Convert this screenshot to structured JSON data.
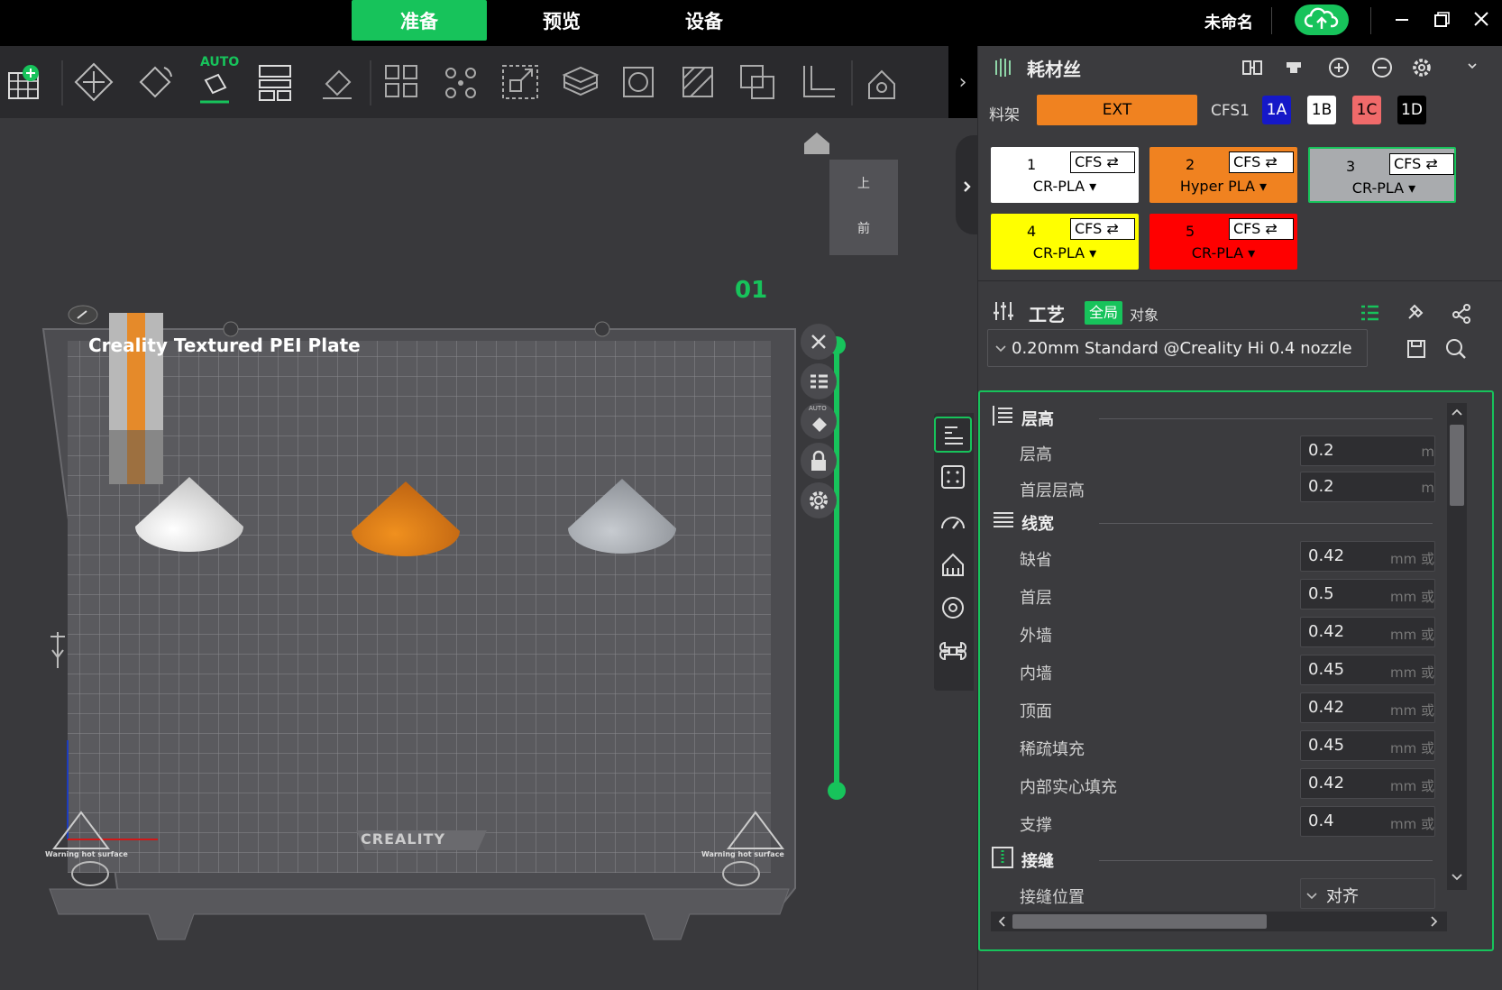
{
  "topbar": {
    "tabs": [
      {
        "label": "准备",
        "active": true
      },
      {
        "label": "预览",
        "active": false
      },
      {
        "label": "设备",
        "active": false
      }
    ],
    "project_title": "未命名",
    "accent": "#17c35b"
  },
  "toolbar": {
    "auto_label": "AUTO",
    "collapse_glyph": "›",
    "tools": [
      "add-plate-icon",
      "arrange-icon",
      "orient-icon",
      "auto-orient-icon",
      "layout-icon",
      "lay-on-face-icon",
      "split-objects-icon",
      "split-parts-icon",
      "scale-icon",
      "cut-icon",
      "hollow-icon",
      "paint-icon",
      "boolean-icon",
      "measure-icon",
      "support-paint-icon"
    ]
  },
  "viewport": {
    "plate_number": "01",
    "plate_name": "Creality Textured PEI Plate",
    "brand": "CREALITY",
    "warning_left": "Warning hot surface",
    "warning_right": "Warning hot surface",
    "view_top": "上",
    "view_front": "前",
    "auto_small": "AUTO"
  },
  "filament": {
    "title": "耗材丝",
    "rack_label": "料架",
    "ext_label": "EXT",
    "cfs_label": "CFS1",
    "slots": [
      {
        "label": "1A",
        "bg": "#1518c8",
        "fg": "#ffffff"
      },
      {
        "label": "1B",
        "bg": "#ffffff",
        "fg": "#000000"
      },
      {
        "label": "1C",
        "bg": "#f06a6a",
        "fg": "#000000"
      },
      {
        "label": "1D",
        "bg": "#000000",
        "fg": "#ffffff"
      }
    ],
    "cards": [
      {
        "num": "1",
        "cfs": "CFS ⇄",
        "material": "CR-PLA ▾",
        "color": "#ffffff",
        "text": "#000000"
      },
      {
        "num": "2",
        "cfs": "CFS ⇄",
        "material": "Hyper PLA ▾",
        "color": "#f08220",
        "text": "#000000"
      },
      {
        "num": "3",
        "cfs": "CFS ⇄",
        "material": "CR-PLA ▾",
        "color": "#a9abae",
        "text": "#000000"
      },
      {
        "num": "4",
        "cfs": "CFS ⇄",
        "material": "CR-PLA ▾",
        "color": "#ffff00",
        "text": "#000000"
      },
      {
        "num": "5",
        "cfs": "CFS ⇄",
        "material": "CR-PLA ▾",
        "color": "#ff0000",
        "text": "#000000"
      }
    ]
  },
  "process": {
    "title": "工艺",
    "global_label": "全局",
    "object_label": "对象",
    "preset": "0.20mm Standard @Creality Hi 0.4 nozzle",
    "sections": [
      {
        "title": "层高",
        "rows": [
          {
            "label": "层高",
            "value": "0.2",
            "unit": "m"
          },
          {
            "label": "首层层高",
            "value": "0.2",
            "unit": "m"
          }
        ]
      },
      {
        "title": "线宽",
        "rows": [
          {
            "label": "缺省",
            "value": "0.42",
            "unit": "mm 或"
          },
          {
            "label": "首层",
            "value": "0.5",
            "unit": "mm 或"
          },
          {
            "label": "外墙",
            "value": "0.42",
            "unit": "mm 或"
          },
          {
            "label": "内墙",
            "value": "0.45",
            "unit": "mm 或"
          },
          {
            "label": "顶面",
            "value": "0.42",
            "unit": "mm 或"
          },
          {
            "label": "稀疏填充",
            "value": "0.45",
            "unit": "mm 或"
          },
          {
            "label": "内部实心填充",
            "value": "0.42",
            "unit": "mm 或"
          },
          {
            "label": "支撑",
            "value": "0.4",
            "unit": "mm 或"
          }
        ]
      },
      {
        "title": "接缝",
        "rows": [
          {
            "label": "接缝位置",
            "value": "对齐",
            "unit": ""
          }
        ]
      }
    ]
  }
}
